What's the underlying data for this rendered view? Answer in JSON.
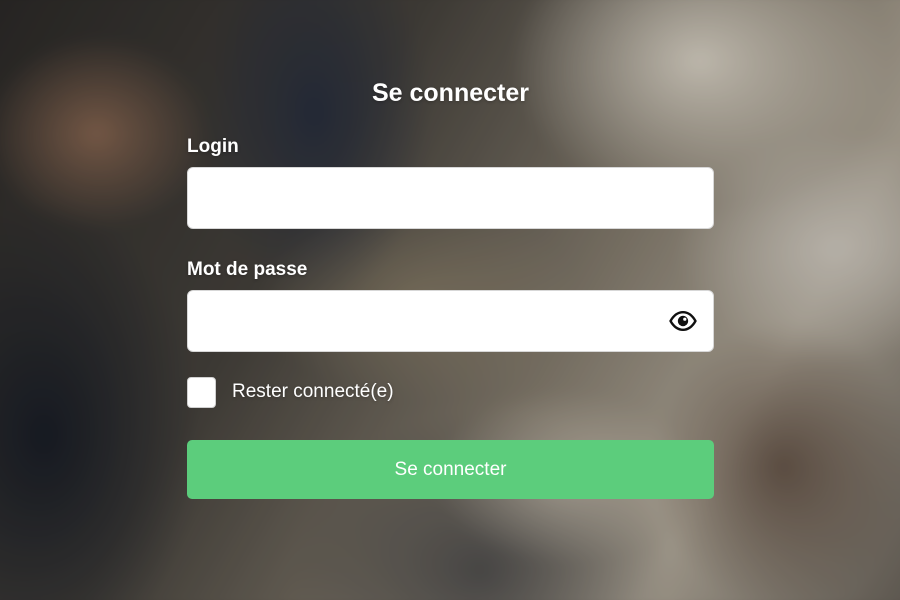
{
  "form": {
    "title": "Se connecter",
    "login": {
      "label": "Login",
      "value": "",
      "placeholder": ""
    },
    "password": {
      "label": "Mot de passe",
      "value": "",
      "placeholder": "",
      "toggle_icon": "eye-icon"
    },
    "remember": {
      "label": "Rester connecté(e)",
      "checked": false
    },
    "submit_label": "Se connecter"
  },
  "colors": {
    "button": "#5ccd7c",
    "text": "#ffffff",
    "input_background": "#ffffff"
  }
}
